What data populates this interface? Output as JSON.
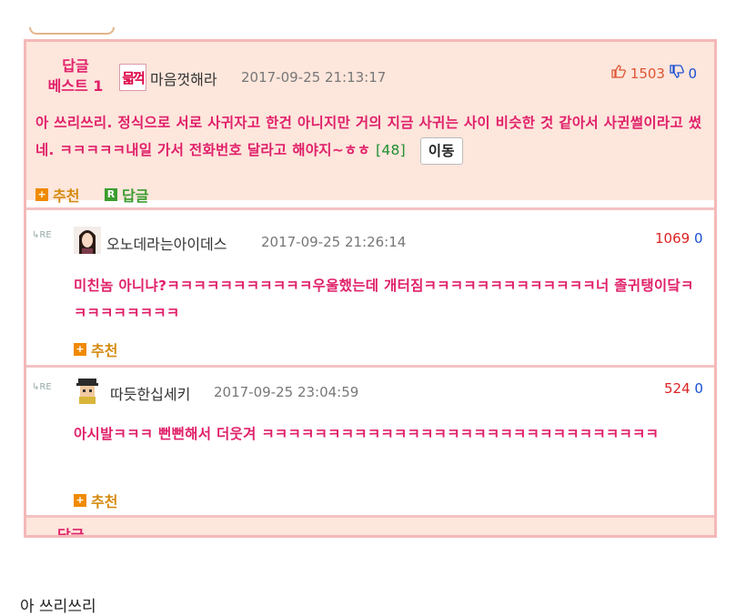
{
  "best_comment": {
    "badge_line1": "답글",
    "badge_line2": "베스트 1",
    "avatar_text": "믋꺽",
    "nickname": "마음껏해라",
    "date": "2017-09-25 21:13:17",
    "upvotes": "1503",
    "downvotes": "0",
    "text": "아 쓰리쓰리. 정식으로 서로 사귀자고 한건 아니지만 거의 지금 사귀는 사이 비슷한 것 같아서 사귄썰이라고 썼네. ㅋㅋㅋㅋㅋ내일 가서 전화번호 달라고 해야지~ㅎㅎ",
    "reply_count": "[48]",
    "move_label": "이동",
    "recommend_label": "추천",
    "reply_label": "답글"
  },
  "replies": [
    {
      "re_mark": "RE",
      "nickname": "오노데라는아이데스",
      "date": "2017-09-25 21:26:14",
      "upvotes": "1069",
      "downvotes": "0",
      "text": "미친놈 아니냐?ㅋㅋㅋㅋㅋㅋㅋㅋㅋㅋㅋ우울했는데 개터짐ㅋㅋㅋㅋㅋㅋㅋㅋㅋㅋㅋㅋㅋ너 졸귀탱이닼ㅋㅋㅋㅋㅋㅋㅋㅋㅋ",
      "recommend_label": "추천"
    },
    {
      "re_mark": "RE",
      "nickname": "따듯한십세키",
      "date": "2017-09-25 23:04:59",
      "upvotes": "524",
      "downvotes": "0",
      "text": "아시발ㅋㅋㅋ 뻔뻔해서 더웃겨 ㅋㅋㅋㅋㅋㅋㅋㅋㅋㅋㅋㅋㅋㅋㅋㅋㅋㅋㅋㅋㅋㅋㅋㅋㅋㅋㅋㅋㅋㅋ",
      "recommend_label": "추천"
    }
  ],
  "next_badge": "답글",
  "caption": "아 쓰리쓰리",
  "colors": {
    "accent": "#e0206a",
    "border": "#f4b8b8",
    "best_bg": "#fde6dc"
  },
  "icons": [
    "thumbs-up-icon",
    "thumbs-down-icon",
    "plus-icon",
    "reply-icon",
    "re-arrow-icon"
  ]
}
